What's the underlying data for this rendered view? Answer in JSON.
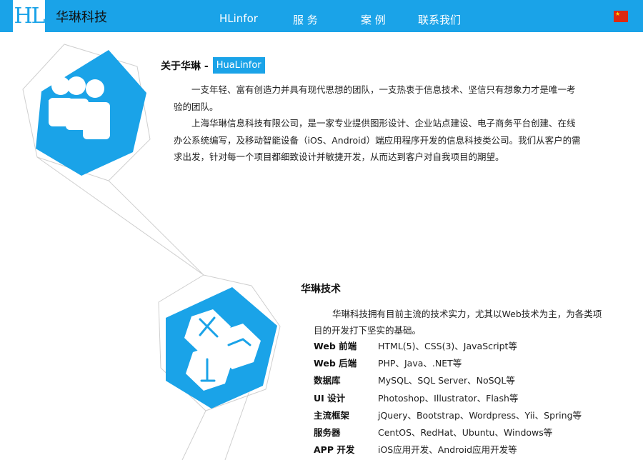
{
  "header": {
    "logo": "HL",
    "brand": "华琳科技",
    "nav": [
      "HLinfor",
      "服 务",
      "案 例",
      "联系我们"
    ],
    "flag_icon": "china-flag-icon",
    "colors": {
      "primary": "#1aa3e8"
    }
  },
  "about": {
    "title": "关于华琳 -",
    "tag": "HuaLinfor",
    "icon": "people-icon",
    "paragraphs": [
      "一支年轻、富有创造力并具有现代思想的团队，一支热衷于信息技术、坚信只有想象力才是唯一考验的团队。",
      "上海华琳信息科技有限公司，是一家专业提供图形设计、企业站点建设、电子商务平台创建、在线办公系统编写，及移动智能设备（iOS、Android）端应用程序开发的信息科技类公司。我们从客户的需求出发，针对每一个项目都细致设计并敏捷开发，从而达到客户对自我项目的期望。"
    ]
  },
  "tech": {
    "title": "华琳技术",
    "icon": "tools-icon",
    "intro": "华琳科技拥有目前主流的技术实力，尤其以Web技术为主，为各类项目的开发打下坚实的基础。",
    "rows": [
      {
        "key": "Web 前端",
        "value": "HTML(5)、CSS(3)、JavaScript等"
      },
      {
        "key": "Web 后端",
        "value": "PHP、Java、.NET等"
      },
      {
        "key": "数据库",
        "value": "MySQL、SQL Server、NoSQL等"
      },
      {
        "key": "UI 设计",
        "value": "Photoshop、Illustrator、Flash等"
      },
      {
        "key": "主流框架",
        "value": "jQuery、Bootstrap、Wordpress、Yii、Spring等"
      },
      {
        "key": "服务器",
        "value": "CentOS、RedHat、Ubuntu、Windows等"
      },
      {
        "key": "APP 开发",
        "value": "iOS应用开发、Android应用开发等"
      }
    ]
  }
}
